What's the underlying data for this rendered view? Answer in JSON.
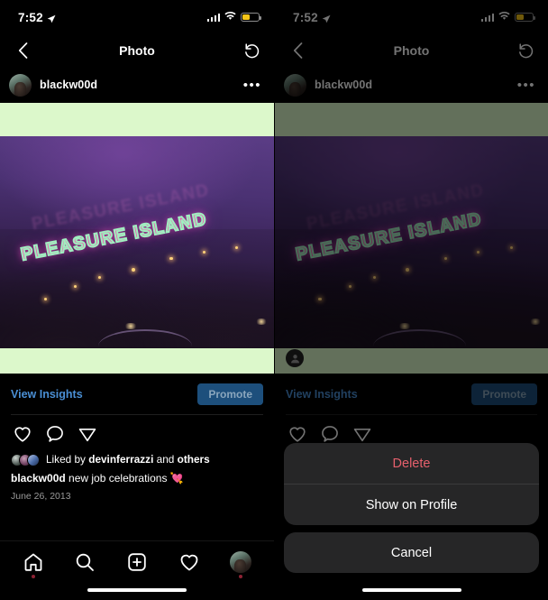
{
  "status_bar": {
    "time": "7:52",
    "location_icon": "location-arrow-icon",
    "signal_icon": "cellular-signal-icon",
    "wifi_icon": "wifi-icon",
    "battery_icon": "battery-low-power-icon"
  },
  "nav": {
    "back_icon": "chevron-left-icon",
    "title": "Photo",
    "refresh_icon": "counter-clockwise-arrow-icon"
  },
  "post": {
    "username": "blackw00d",
    "avatar_icon": "user-avatar",
    "more_icon": "more-options-icon",
    "image_alt": "PLEASURE ISLAND neon sign at night",
    "sign_text": "PLEASURE ISLAND",
    "profile_chip_icon": "person-placeholder-icon"
  },
  "insights": {
    "view_insights_label": "View Insights",
    "promote_label": "Promote"
  },
  "actions": {
    "like_icon": "heart-icon",
    "comment_icon": "comment-bubble-icon",
    "share_icon": "share-paper-plane-icon"
  },
  "liked_by": {
    "prefix": "Liked by",
    "user": "devinferrazzi",
    "middle": "and",
    "suffix": "others"
  },
  "caption": {
    "username": "blackw00d",
    "text": "new job celebrations",
    "emoji": "💘",
    "date": "June 26, 2013"
  },
  "tabbar": {
    "items": [
      {
        "name": "home",
        "icon": "home-icon",
        "badge": true
      },
      {
        "name": "search",
        "icon": "search-icon",
        "badge": false
      },
      {
        "name": "create",
        "icon": "plus-square-icon",
        "badge": false
      },
      {
        "name": "activity",
        "icon": "heart-icon",
        "badge": false
      },
      {
        "name": "profile",
        "icon": "profile-avatar-icon",
        "badge": true
      }
    ]
  },
  "action_sheet": {
    "delete_label": "Delete",
    "show_on_profile_label": "Show on Profile",
    "cancel_label": "Cancel"
  },
  "colors": {
    "link_blue": "#4a8fd4",
    "promote_blue": "#1d4f7c",
    "danger_red": "#e5606c",
    "photo_band": "#dcf8cb",
    "neon_pink": "#f05ab0",
    "neon_green": "#9ff0c0"
  }
}
